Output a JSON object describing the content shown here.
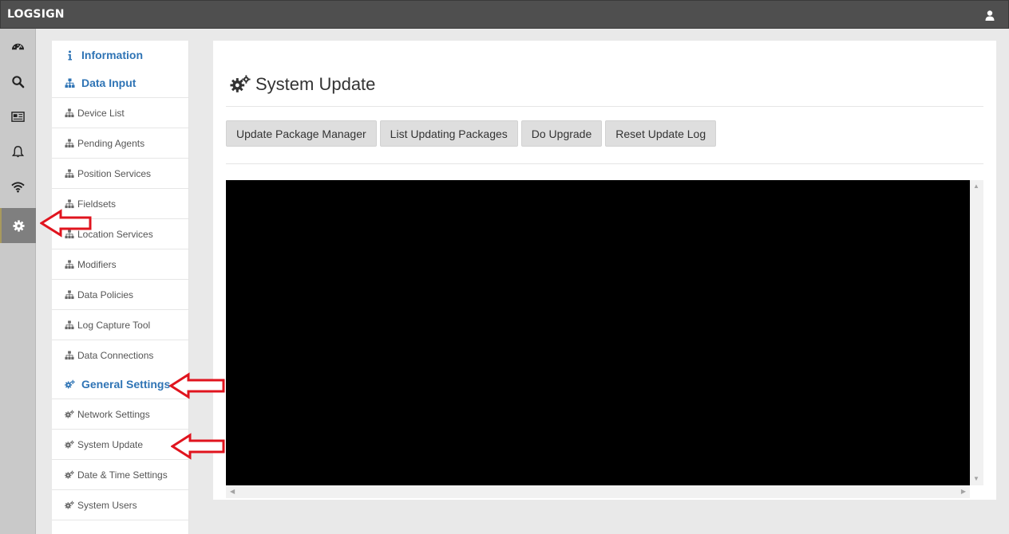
{
  "topbar": {
    "brand": "LOGSIGN",
    "user_icon": "user-icon"
  },
  "iconbar": {
    "items": [
      {
        "icon": "dashboard-icon",
        "active": false
      },
      {
        "icon": "search-icon",
        "active": false
      },
      {
        "icon": "newspaper-icon",
        "active": false
      },
      {
        "icon": "bell-icon",
        "active": false
      },
      {
        "icon": "wifi-icon",
        "active": false
      },
      {
        "icon": "gear-icon",
        "active": true
      }
    ]
  },
  "sidebar": {
    "information": "Information",
    "data_input": "Data Input",
    "data_input_items": [
      "Device List",
      "Pending Agents",
      "Position Services",
      "Fieldsets",
      "Location Services",
      "Modifiers",
      "Data Policies",
      "Log Capture Tool",
      "Data Connections"
    ],
    "general_settings": "General Settings",
    "general_settings_items": [
      "Network Settings",
      "System Update",
      "Date & Time Settings",
      "System Users"
    ]
  },
  "main": {
    "title": "System Update",
    "buttons": [
      "Update Package Manager",
      "List Updating Packages",
      "Do Upgrade",
      "Reset Update Log"
    ]
  },
  "colors": {
    "topbar": "#4f4f4f",
    "link": "#2f74b5",
    "annotation_arrow": "#e0141e",
    "terminal": "#000000"
  }
}
